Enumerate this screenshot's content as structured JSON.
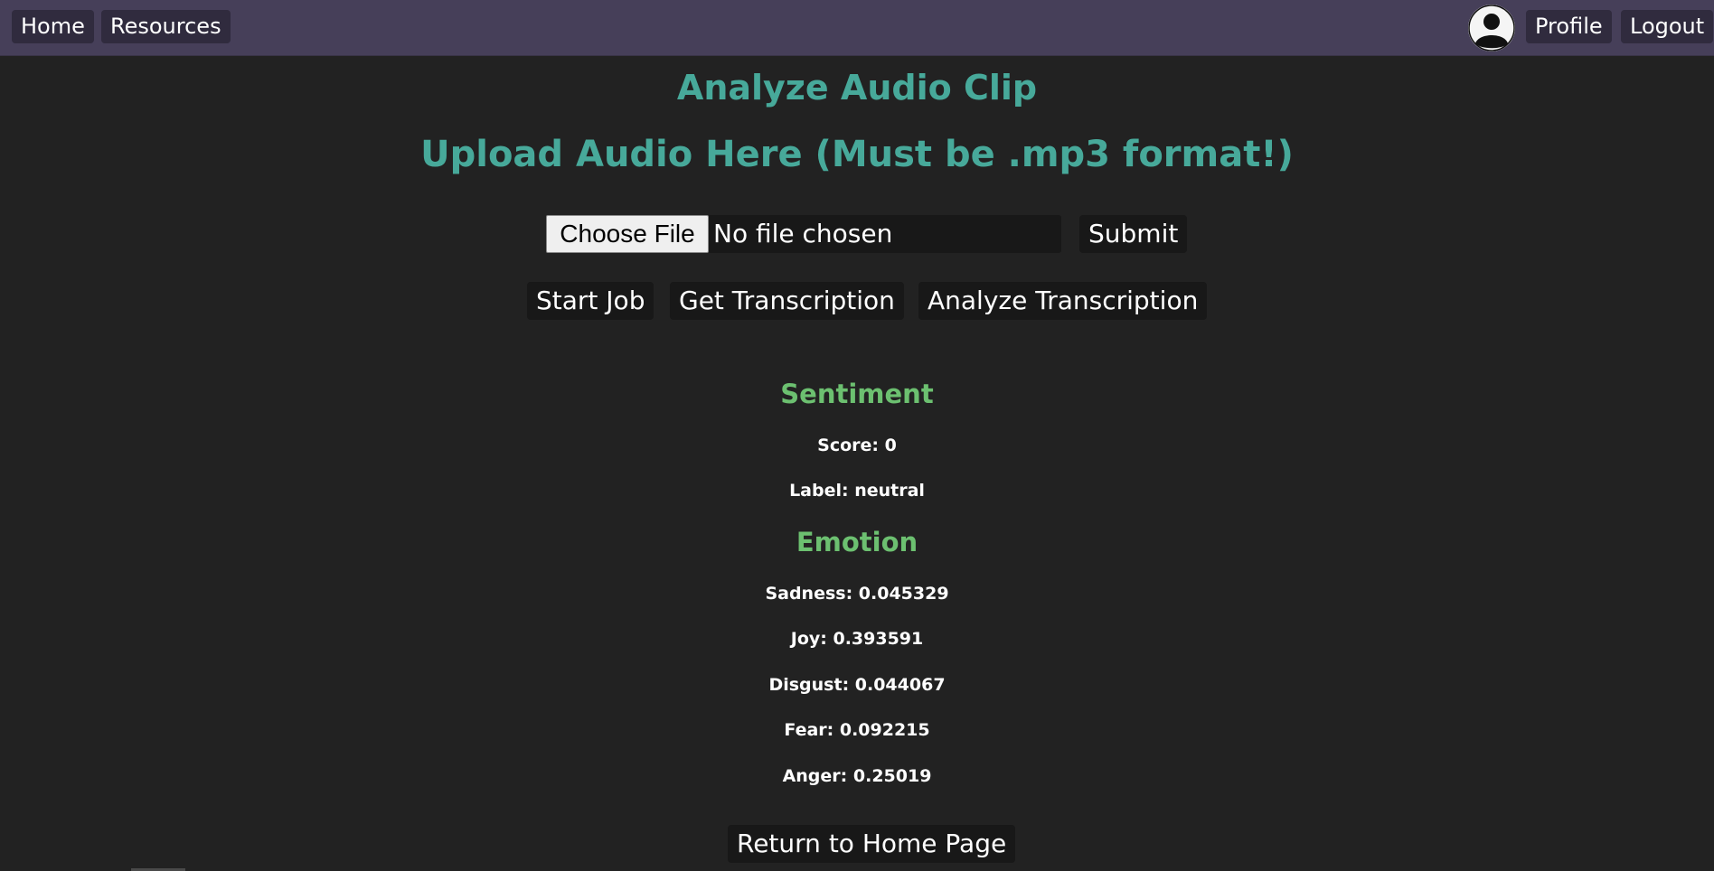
{
  "nav": {
    "home_label": "Home",
    "resources_label": "Resources",
    "profile_label": "Profile",
    "logout_label": "Logout",
    "avatar_icon": "user-avatar-icon"
  },
  "page": {
    "title": "Analyze Audio Clip",
    "upload_heading": "Upload Audio Here (Must be .mp3 format!)"
  },
  "upload": {
    "choose_file_label": "Choose File",
    "file_status": "No file chosen",
    "submit_label": "Submit"
  },
  "actions": {
    "start_job_label": "Start Job",
    "get_transcription_label": "Get Transcription",
    "analyze_transcription_label": "Analyze Transcription"
  },
  "sentiment": {
    "title": "Sentiment",
    "score": "Score: 0",
    "label": "Label: neutral"
  },
  "emotion": {
    "title": "Emotion",
    "sadness": "Sadness: 0.045329",
    "joy": "Joy: 0.393591",
    "disgust": "Disgust: 0.044067",
    "fear": "Fear: 0.092215",
    "anger": "Anger: 0.25019"
  },
  "footer": {
    "return_label": "Return to Home Page"
  },
  "colors": {
    "navbar": "#463f59",
    "background": "#222222",
    "heading": "#47a99a",
    "section_title": "#6cc070"
  }
}
